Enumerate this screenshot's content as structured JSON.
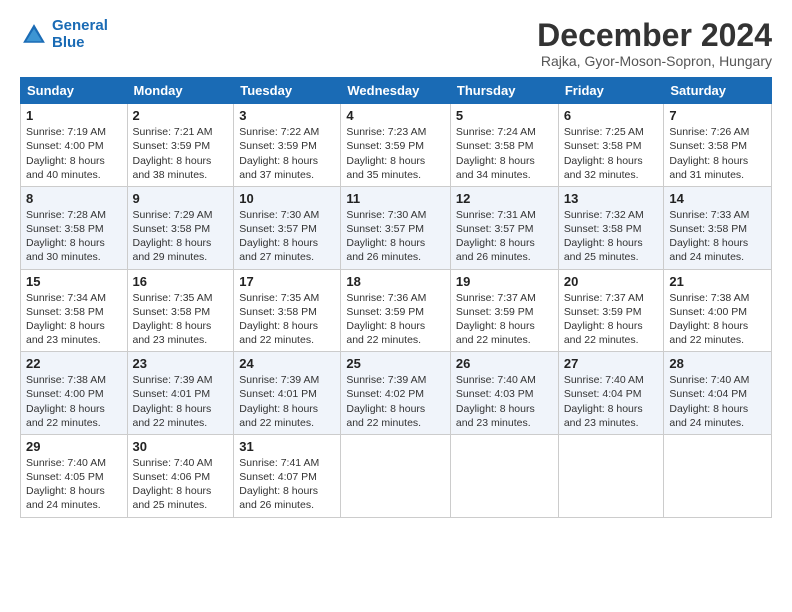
{
  "logo": {
    "line1": "General",
    "line2": "Blue"
  },
  "title": "December 2024",
  "subtitle": "Rajka, Gyor-Moson-Sopron, Hungary",
  "headers": [
    "Sunday",
    "Monday",
    "Tuesday",
    "Wednesday",
    "Thursday",
    "Friday",
    "Saturday"
  ],
  "weeks": [
    [
      {
        "day": "1",
        "sunrise": "7:19 AM",
        "sunset": "4:00 PM",
        "daylight": "8 hours and 40 minutes."
      },
      {
        "day": "2",
        "sunrise": "7:21 AM",
        "sunset": "3:59 PM",
        "daylight": "8 hours and 38 minutes."
      },
      {
        "day": "3",
        "sunrise": "7:22 AM",
        "sunset": "3:59 PM",
        "daylight": "8 hours and 37 minutes."
      },
      {
        "day": "4",
        "sunrise": "7:23 AM",
        "sunset": "3:59 PM",
        "daylight": "8 hours and 35 minutes."
      },
      {
        "day": "5",
        "sunrise": "7:24 AM",
        "sunset": "3:58 PM",
        "daylight": "8 hours and 34 minutes."
      },
      {
        "day": "6",
        "sunrise": "7:25 AM",
        "sunset": "3:58 PM",
        "daylight": "8 hours and 32 minutes."
      },
      {
        "day": "7",
        "sunrise": "7:26 AM",
        "sunset": "3:58 PM",
        "daylight": "8 hours and 31 minutes."
      }
    ],
    [
      {
        "day": "8",
        "sunrise": "7:28 AM",
        "sunset": "3:58 PM",
        "daylight": "8 hours and 30 minutes."
      },
      {
        "day": "9",
        "sunrise": "7:29 AM",
        "sunset": "3:58 PM",
        "daylight": "8 hours and 29 minutes."
      },
      {
        "day": "10",
        "sunrise": "7:30 AM",
        "sunset": "3:57 PM",
        "daylight": "8 hours and 27 minutes."
      },
      {
        "day": "11",
        "sunrise": "7:30 AM",
        "sunset": "3:57 PM",
        "daylight": "8 hours and 26 minutes."
      },
      {
        "day": "12",
        "sunrise": "7:31 AM",
        "sunset": "3:57 PM",
        "daylight": "8 hours and 26 minutes."
      },
      {
        "day": "13",
        "sunrise": "7:32 AM",
        "sunset": "3:58 PM",
        "daylight": "8 hours and 25 minutes."
      },
      {
        "day": "14",
        "sunrise": "7:33 AM",
        "sunset": "3:58 PM",
        "daylight": "8 hours and 24 minutes."
      }
    ],
    [
      {
        "day": "15",
        "sunrise": "7:34 AM",
        "sunset": "3:58 PM",
        "daylight": "8 hours and 23 minutes."
      },
      {
        "day": "16",
        "sunrise": "7:35 AM",
        "sunset": "3:58 PM",
        "daylight": "8 hours and 23 minutes."
      },
      {
        "day": "17",
        "sunrise": "7:35 AM",
        "sunset": "3:58 PM",
        "daylight": "8 hours and 22 minutes."
      },
      {
        "day": "18",
        "sunrise": "7:36 AM",
        "sunset": "3:59 PM",
        "daylight": "8 hours and 22 minutes."
      },
      {
        "day": "19",
        "sunrise": "7:37 AM",
        "sunset": "3:59 PM",
        "daylight": "8 hours and 22 minutes."
      },
      {
        "day": "20",
        "sunrise": "7:37 AM",
        "sunset": "3:59 PM",
        "daylight": "8 hours and 22 minutes."
      },
      {
        "day": "21",
        "sunrise": "7:38 AM",
        "sunset": "4:00 PM",
        "daylight": "8 hours and 22 minutes."
      }
    ],
    [
      {
        "day": "22",
        "sunrise": "7:38 AM",
        "sunset": "4:00 PM",
        "daylight": "8 hours and 22 minutes."
      },
      {
        "day": "23",
        "sunrise": "7:39 AM",
        "sunset": "4:01 PM",
        "daylight": "8 hours and 22 minutes."
      },
      {
        "day": "24",
        "sunrise": "7:39 AM",
        "sunset": "4:01 PM",
        "daylight": "8 hours and 22 minutes."
      },
      {
        "day": "25",
        "sunrise": "7:39 AM",
        "sunset": "4:02 PM",
        "daylight": "8 hours and 22 minutes."
      },
      {
        "day": "26",
        "sunrise": "7:40 AM",
        "sunset": "4:03 PM",
        "daylight": "8 hours and 23 minutes."
      },
      {
        "day": "27",
        "sunrise": "7:40 AM",
        "sunset": "4:04 PM",
        "daylight": "8 hours and 23 minutes."
      },
      {
        "day": "28",
        "sunrise": "7:40 AM",
        "sunset": "4:04 PM",
        "daylight": "8 hours and 24 minutes."
      }
    ],
    [
      {
        "day": "29",
        "sunrise": "7:40 AM",
        "sunset": "4:05 PM",
        "daylight": "8 hours and 24 minutes."
      },
      {
        "day": "30",
        "sunrise": "7:40 AM",
        "sunset": "4:06 PM",
        "daylight": "8 hours and 25 minutes."
      },
      {
        "day": "31",
        "sunrise": "7:41 AM",
        "sunset": "4:07 PM",
        "daylight": "8 hours and 26 minutes."
      },
      null,
      null,
      null,
      null
    ]
  ]
}
